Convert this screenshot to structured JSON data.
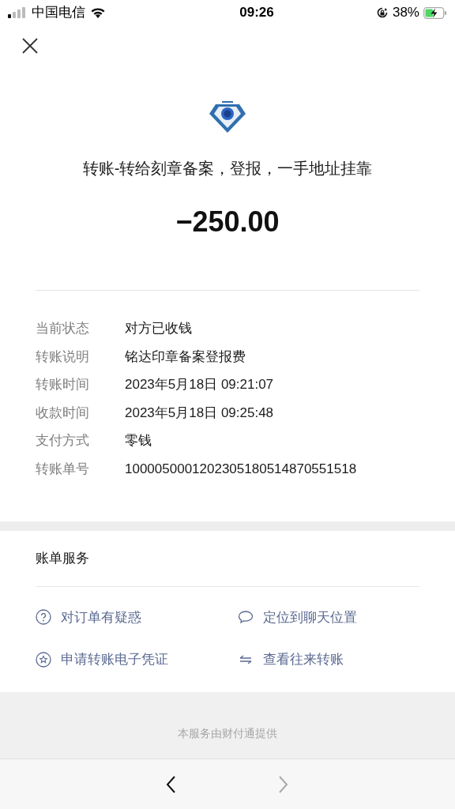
{
  "status_bar": {
    "carrier": "中国电信",
    "time": "09:26",
    "battery": "38%"
  },
  "transfer": {
    "title": "转账-转给刻章备案，登报，一手地址挂靠",
    "amount": "−250.00"
  },
  "details": [
    {
      "label": "当前状态",
      "value": "对方已收钱"
    },
    {
      "label": "转账说明",
      "value": "铭达印章备案登报费"
    },
    {
      "label": "转账时间",
      "value": "2023年5月18日 09:21:07"
    },
    {
      "label": "收款时间",
      "value": "2023年5月18日 09:25:48"
    },
    {
      "label": "支付方式",
      "value": "零钱"
    },
    {
      "label": "转账单号",
      "value": "1000050001202305180514870551518"
    }
  ],
  "services": {
    "title": "账单服务",
    "items": [
      {
        "kind": "question",
        "label": "对订单有疑惑"
      },
      {
        "kind": "chat",
        "label": "定位到聊天位置"
      },
      {
        "kind": "star",
        "label": "申请转账电子凭证"
      },
      {
        "kind": "transfer",
        "label": "查看往来转账"
      }
    ]
  },
  "footer": "本服务由财付通提供",
  "nav": [
    {
      "kind": "back",
      "disabled": false
    },
    {
      "kind": "forward",
      "disabled": true
    }
  ]
}
